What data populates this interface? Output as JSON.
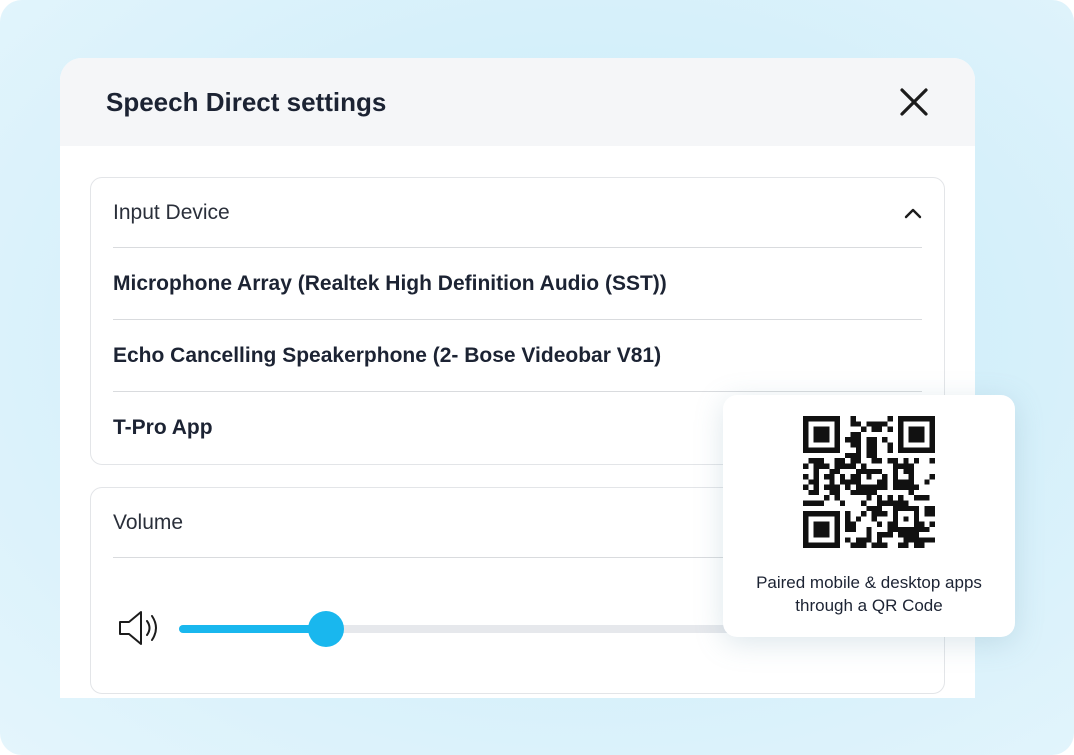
{
  "dialog": {
    "title": "Speech Direct settings",
    "close_icon": "close-icon"
  },
  "input_device": {
    "label": "Input Device",
    "toggle_icon": "chevron-up-icon",
    "devices": [
      "Microphone Array (Realtek High Definition Audio (SST))",
      "Echo Cancelling Speakerphone (2- Bose Videobar V81)",
      "T-Pro App"
    ]
  },
  "volume": {
    "label": "Volume",
    "icon": "speaker-icon",
    "level": 0.21
  },
  "qr_card": {
    "icon": "qr-code-icon",
    "caption_line1": "Paired mobile & desktop apps",
    "caption_line2": "through a QR Code"
  },
  "colors": {
    "accent": "#19b7ee",
    "title_text": "#1c2333",
    "header_bg": "#f5f6f8"
  }
}
